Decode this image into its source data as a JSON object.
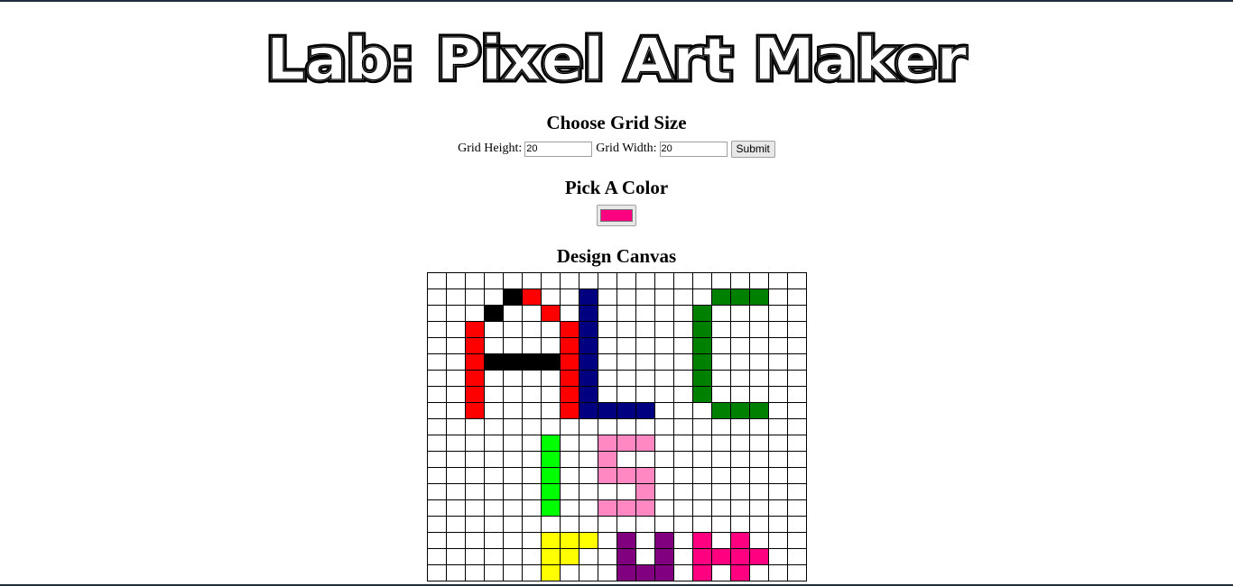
{
  "page_title": "Lab: Pixel Art Maker",
  "grid_size": {
    "heading": "Choose Grid Size",
    "height_label": "Grid Height:",
    "height_value": "20",
    "width_label": "Grid Width:",
    "width_value": "20",
    "submit_label": "Submit"
  },
  "color": {
    "heading": "Pick A Color",
    "selected": "#ff0080"
  },
  "canvas": {
    "heading": "Design Canvas",
    "palette": {
      "K": "#000000",
      "R": "#ff0000",
      "N": "#000080",
      "G": "#008000",
      "L": "#00ff00",
      "P": "#ff88c3",
      "Y": "#ffff00",
      "V": "#800080",
      "M": "#ff0080"
    },
    "rows": [
      "....................",
      "....KR..N......GGG..",
      "...K..R.N.....G.....",
      "..R....RN.....G.....",
      "..R....RN.....G.....",
      "..RKKKKRN.....G.....",
      "..R....RN.....G.....",
      "..R....RN.....G.....",
      "..R....RNNNN...GGG..",
      "....................",
      "......L..PPP........",
      "......L..P..........",
      "......L..PPP........",
      "......L....P........",
      "......L..PPP........",
      "....................",
      "......YYY.V.V.M.M...",
      "......YY..V.V.MMMM..",
      "......Y...VVV.M.M..."
    ],
    "row_count": 19,
    "col_count": 20
  }
}
